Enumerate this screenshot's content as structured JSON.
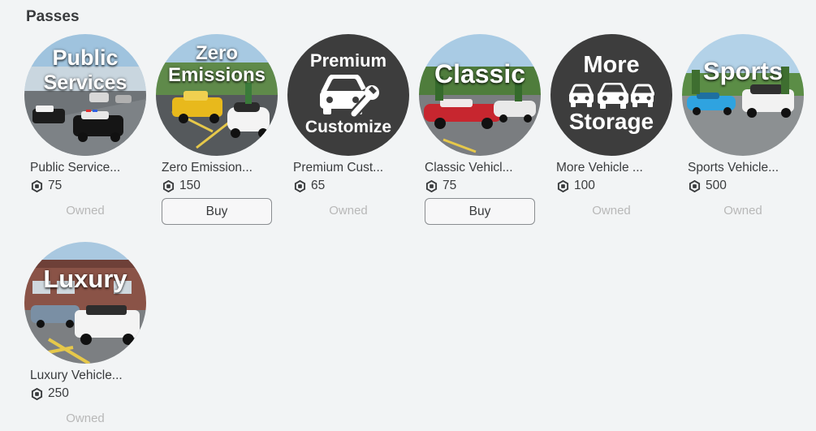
{
  "section": {
    "title": "Passes"
  },
  "passes": [
    {
      "thumb_lines": [
        "Public",
        "Services"
      ],
      "name": "Public Service...",
      "price": "75",
      "status": "Owned"
    },
    {
      "thumb_lines": [
        "Zero",
        "Emissions"
      ],
      "name": "Zero Emission...",
      "price": "150",
      "status": "Buy"
    },
    {
      "thumb_lines": [
        "Premium",
        "Customize"
      ],
      "name": "Premium Cust...",
      "price": "65",
      "status": "Owned"
    },
    {
      "thumb_lines": [
        "Classic"
      ],
      "name": "Classic Vehicl...",
      "price": "75",
      "status": "Buy"
    },
    {
      "thumb_lines": [
        "More",
        "Storage"
      ],
      "name": "More Vehicle ...",
      "price": "100",
      "status": "Owned"
    },
    {
      "thumb_lines": [
        "Sports"
      ],
      "name": "Sports Vehicle...",
      "price": "500",
      "status": "Owned"
    },
    {
      "thumb_lines": [
        "Luxury"
      ],
      "name": "Luxury Vehicle...",
      "price": "250",
      "status": "Owned"
    }
  ],
  "icons": {
    "currency": "robux-icon",
    "car": "car-icon",
    "wrench": "wrench-icon"
  },
  "colors": {
    "background": "#f2f4f5",
    "text": "#393b3d",
    "owned_text": "#b8b8b8",
    "button_border": "#8a8d90",
    "dark_thumb": "#3d3d3d"
  }
}
